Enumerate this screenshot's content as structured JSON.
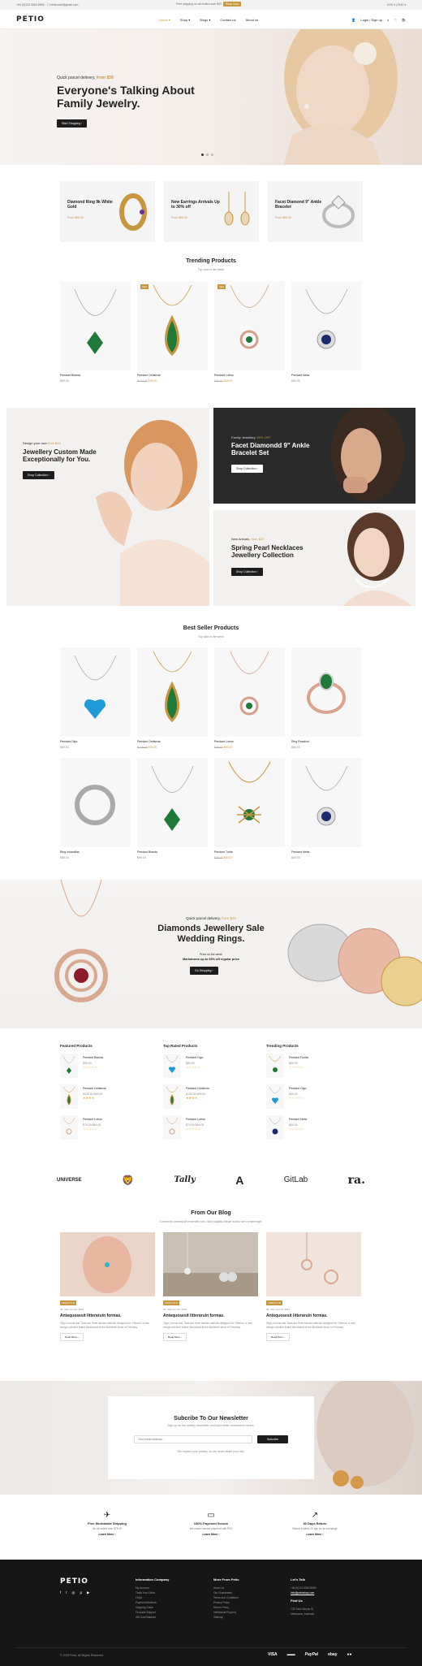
{
  "topbar": {
    "contact": "+84 (0)123 3563 8565 · ☐ infolhome@gmail.com",
    "promo": "Free shipping on all orders over $29",
    "promo_badge": "Shop Now",
    "right": "USD ▾   |   ENG ▾"
  },
  "header": {
    "logo": "PETIO",
    "nav": [
      "Home ▾",
      "Shop ▾",
      "Blogs ▾",
      "Contact us",
      "About us"
    ],
    "account": "Login / Sign up"
  },
  "hero": {
    "subtitle_prefix": "Quick parcel delivery,",
    "subtitle_highlight": "from $59",
    "title": "Everyone's Talking About Family Jewelry.",
    "button": "Start Shopping  ›"
  },
  "promos": [
    {
      "title": "Diamond Ring 9k White Gold",
      "link": "From $98.00"
    },
    {
      "title": "New Earrings Arrivals Up to 30% off",
      "link": "From $98.00"
    },
    {
      "title": "Facet Diamond 9\" Ankle Bracelet",
      "link": "From $98.00"
    }
  ],
  "trending": {
    "title": "Trending Products",
    "subtitle": "Top view in the week",
    "products": [
      {
        "name": "Pendant Bianda",
        "price": "$99.00",
        "old": "",
        "tag": ""
      },
      {
        "name": "Pendant Cefalexia",
        "price": "$99.00",
        "old": "$130.00",
        "tag": "Sale"
      },
      {
        "name": "Pendant Lolma",
        "price": "$69.00",
        "old": "$79.00",
        "tag": "Sale"
      },
      {
        "name": "Pendant Netta",
        "price": "$60.00",
        "old": "",
        "tag": ""
      }
    ]
  },
  "banners": {
    "custom": {
      "sub_prefix": "Design your own",
      "sub_highlight": "from $15",
      "title": "Jewellery Custom Made Exceptionally for You.",
      "button": "Shop Collection  ›"
    },
    "facet": {
      "sub_prefix": "Family Jewellery,",
      "sub_highlight": "50% OFF",
      "title": "Facet Diamondd 9\" Ankle Bracelet Set",
      "button": "Shop Collection  ›"
    },
    "spring": {
      "sub_prefix": "New Arrivals,",
      "sub_highlight": "from $20",
      "title": "Spring Pearl Necklaces Jewellery Collection",
      "button": "Shop Collection  ›"
    }
  },
  "bestseller": {
    "title": "Best Seller Products",
    "subtitle": "Top sale in the week",
    "products": [
      {
        "name": "Pendant Olgo",
        "price": "$60.00",
        "old": "",
        "tag": ""
      },
      {
        "name": "Pendant Cefalexia",
        "price": "$99.00",
        "old": "$130.00",
        "tag": ""
      },
      {
        "name": "Pendant Lolma",
        "price": "$69.00",
        "old": "$79.00",
        "tag": ""
      },
      {
        "name": "Ring Rosalind",
        "price": "$50.00",
        "old": "",
        "tag": ""
      },
      {
        "name": "Ring Ishamilias",
        "price": "$85.00",
        "old": "",
        "tag": ""
      },
      {
        "name": "Pendant Bianda",
        "price": "$99.00",
        "old": "",
        "tag": ""
      },
      {
        "name": "Pendant Turtle",
        "price": "$60.00",
        "old": "$70.00",
        "tag": ""
      },
      {
        "name": "Pendant Netta",
        "price": "$60.00",
        "old": "",
        "tag": ""
      }
    ]
  },
  "sale": {
    "sub_prefix": "Quick parcel delivery,",
    "sub_highlight": "from $25",
    "title": "Diamonds Jewellery Sale Wedding Rings.",
    "line1": "Price on the week",
    "line2": "Markdowns up to 69% off regular price",
    "button": "Go Shopping  ›"
  },
  "lists": [
    {
      "title": "Featured Products",
      "items": [
        {
          "name": "Pendant Bianda",
          "price": "$99.00",
          "rating": "☆☆☆☆☆"
        },
        {
          "name": "Pendant Cefalexia",
          "price": "$130.00  $99.00",
          "rating": "★★★★"
        },
        {
          "name": "Pendant Lolma",
          "price": "$79.00  $69.00",
          "rating": "☆☆☆☆☆"
        }
      ]
    },
    {
      "title": "Top Rated Products",
      "items": [
        {
          "name": "Pendant Olgo",
          "price": "$60.00",
          "rating": "☆☆☆☆☆"
        },
        {
          "name": "Pendant Cefalexia",
          "price": "$130.00  $99.00",
          "rating": "★★★★"
        },
        {
          "name": "Pendant Lolma",
          "price": "$79.00  $69.00",
          "rating": "☆☆☆☆☆"
        }
      ]
    },
    {
      "title": "Trending Products",
      "items": [
        {
          "name": "Pendant Fiorita",
          "price": "$60.00",
          "rating": "☆☆☆☆☆"
        },
        {
          "name": "Pendant Olgo",
          "price": "$60.00",
          "rating": "☆☆☆☆☆"
        },
        {
          "name": "Pendant Netta",
          "price": "$60.00",
          "rating": "☆☆☆☆☆"
        }
      ]
    }
  ],
  "brands": [
    "UNIVERSE",
    "🦁",
    "Tally",
    "A",
    "GitLab",
    "ra."
  ],
  "blog": {
    "title": "From Our Blog",
    "subtitle": "Commodo consequat venenatis sed, dolor sagittis integer luctus sem ornare eget.",
    "posts": [
      {
        "cat": "LIFESTYLE",
        "meta": "Mr. Vatu    Jun 20, 2023",
        "title": "Antequosesit litteraruin formas.",
        "desc": "Olga, humus and Tizas are three kitchen utensils designed for Ohmmo; a new design-oriented brand introduced at the Ambiente show in February.",
        "rm": "Read More  ›"
      },
      {
        "cat": "LIFESTYLE",
        "meta": "Mr. Vatu    Jun 20, 2023",
        "title": "Antequosesit litteraruin formas.",
        "desc": "Olga, humus and Tizas are three kitchen utensils designed for Ohmmo; a new design-oriented brand introduced at the Ambiente show in February.",
        "rm": "Read More  ›"
      },
      {
        "cat": "LIFESTYLE",
        "meta": "Mr. Vatu    Jun 20, 2023",
        "title": "Antequosesit litteraruin formas.",
        "desc": "Olga, humus and Tizas are three kitchen utensils designed for Ohmmo; a new design-oriented brand introduced at the Ambiente show in February.",
        "rm": "Read More  ›"
      }
    ]
  },
  "newsletter": {
    "title": "Subcribe To Our Newsletter",
    "desc": "Sign up for the weekly newsletter and build better ecommerce stores.",
    "placeholder": "Your email address...",
    "button": "Subcribe",
    "note": "We respect your privacy, so we never share your info."
  },
  "features": [
    {
      "icon": "✈",
      "title": "Free Worldwide Shipping",
      "desc": "On all orders over $75.00",
      "link": "Learn More  ›"
    },
    {
      "icon": "▭",
      "title": "100% Payment Secure",
      "desc": "We ensure secure payment with PEV",
      "link": "Learn More  ›"
    },
    {
      "icon": "↗",
      "title": "30 Days Return",
      "desc": "Return it within 30 day for an exchange",
      "link": "Learn More  ›"
    }
  ],
  "footer": {
    "logo": "PETIO",
    "social": [
      "f",
      "t",
      "◎",
      "p",
      "▶"
    ],
    "col1": {
      "title": "Information Company",
      "items": [
        "My Account",
        "Track Your Order",
        "FAQs",
        "Payment Methods",
        "Shipping Guide",
        "Products Support",
        "Gift Card Balance"
      ]
    },
    "col2": {
      "title": "More From Petio",
      "items": [
        "About Us",
        "Our Guarantees",
        "Terms and Conditions",
        "Privacy Policy",
        "Return Policy",
        "Intellectual Property",
        "Sitemap"
      ]
    },
    "col3": {
      "title": "Let's Talk",
      "phone": "+84 (0)123 3563 8565",
      "email": "Info@petioshop.com",
      "find": "Find Us",
      "addr1": "7/22 New Steyne St",
      "addr2": "Melbourne, Australia"
    },
    "copyright": "© 2022 Petio. All Rights Reserved.",
    "payments": [
      "VISA",
      "▬▬",
      "PayPal",
      "ebay",
      "●●"
    ]
  },
  "colors": {
    "accent": "#c8963e",
    "dark": "#1d1d1d",
    "footer": "#161616"
  }
}
